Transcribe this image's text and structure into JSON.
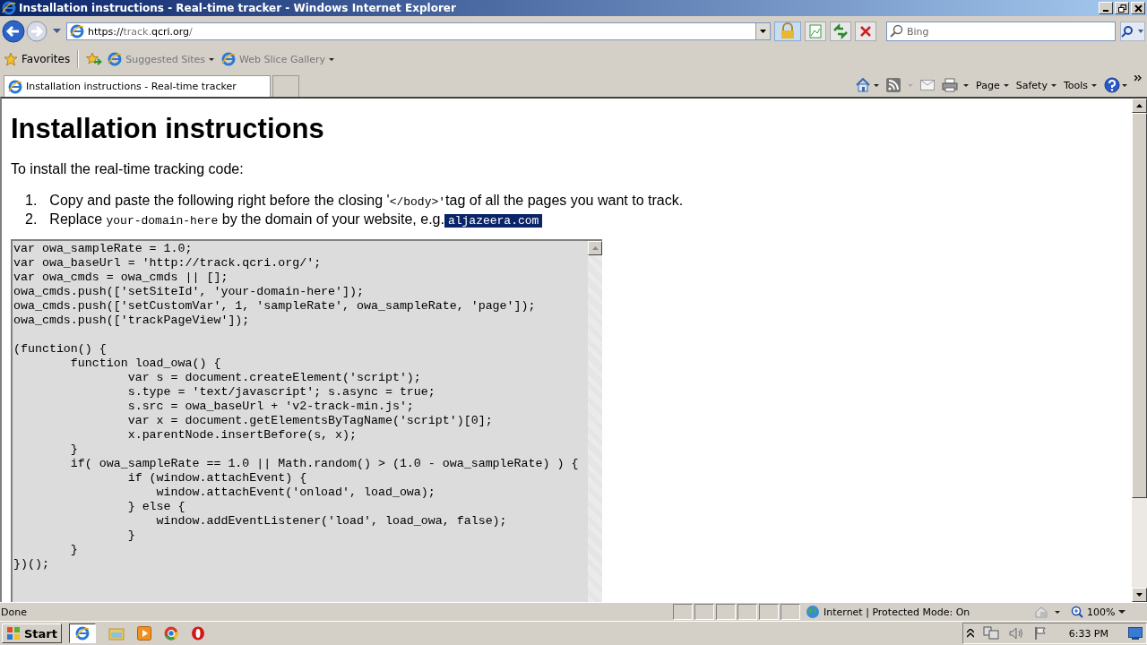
{
  "window": {
    "title": "Installation instructions - Real-time tracker - Windows Internet Explorer"
  },
  "address_bar": {
    "url_parts": [
      {
        "text": "https://",
        "dim": false
      },
      {
        "text": "track.",
        "dim": true
      },
      {
        "text": "qcri.org",
        "dim": false
      },
      {
        "text": "/",
        "dim": true
      }
    ]
  },
  "search": {
    "placeholder": "Bing"
  },
  "favorites_bar": {
    "label": "Favorites",
    "links": [
      "Suggested Sites",
      "Web Slice Gallery"
    ]
  },
  "tabs": [
    {
      "label": "Installation instructions - Real-time tracker",
      "selected": true
    }
  ],
  "command_bar": [
    "Page",
    "Safety",
    "Tools"
  ],
  "page": {
    "heading": "Installation instructions",
    "intro": "To install the real-time tracking code:",
    "steps": [
      {
        "number": "1.",
        "parts": [
          {
            "kind": "text",
            "text": "Copy and paste the following right before the closing '"
          },
          {
            "kind": "code",
            "text": "</body>'"
          },
          {
            "kind": "text",
            "text": "tag of all the pages you want to track."
          }
        ]
      },
      {
        "number": "2.",
        "parts": [
          {
            "kind": "text",
            "text": "Replace "
          },
          {
            "kind": "code",
            "text": "your-domain-here"
          },
          {
            "kind": "text",
            "text": " by the domain of your website, e.g."
          },
          {
            "kind": "highlight",
            "text": "aljazeera.com"
          }
        ]
      }
    ],
    "code": "var owa_sampleRate = 1.0;\nvar owa_baseUrl = 'http://track.qcri.org/';\nvar owa_cmds = owa_cmds || [];\nowa_cmds.push(['setSiteId', 'your-domain-here']);\nowa_cmds.push(['setCustomVar', 1, 'sampleRate', owa_sampleRate, 'page']);\nowa_cmds.push(['trackPageView']);\n\n(function() {\n        function load_owa() {\n                var s = document.createElement('script');\n                s.type = 'text/javascript'; s.async = true;\n                s.src = owa_baseUrl + 'v2-track-min.js';\n                var x = document.getElementsByTagName('script')[0];\n                x.parentNode.insertBefore(s, x);\n        }\n        if( owa_sampleRate == 1.0 || Math.random() > (1.0 - owa_sampleRate) ) {\n                if (window.attachEvent) {\n                    window.attachEvent('onload', load_owa);\n                } else {\n                    window.addEventListener('load', load_owa, false);\n                }\n        }\n})();"
  },
  "status_bar": {
    "text": "Done",
    "zone": "Internet | Protected Mode: On",
    "zoom": "100%"
  },
  "taskbar": {
    "start": "Start",
    "clock": "6:33 PM"
  }
}
